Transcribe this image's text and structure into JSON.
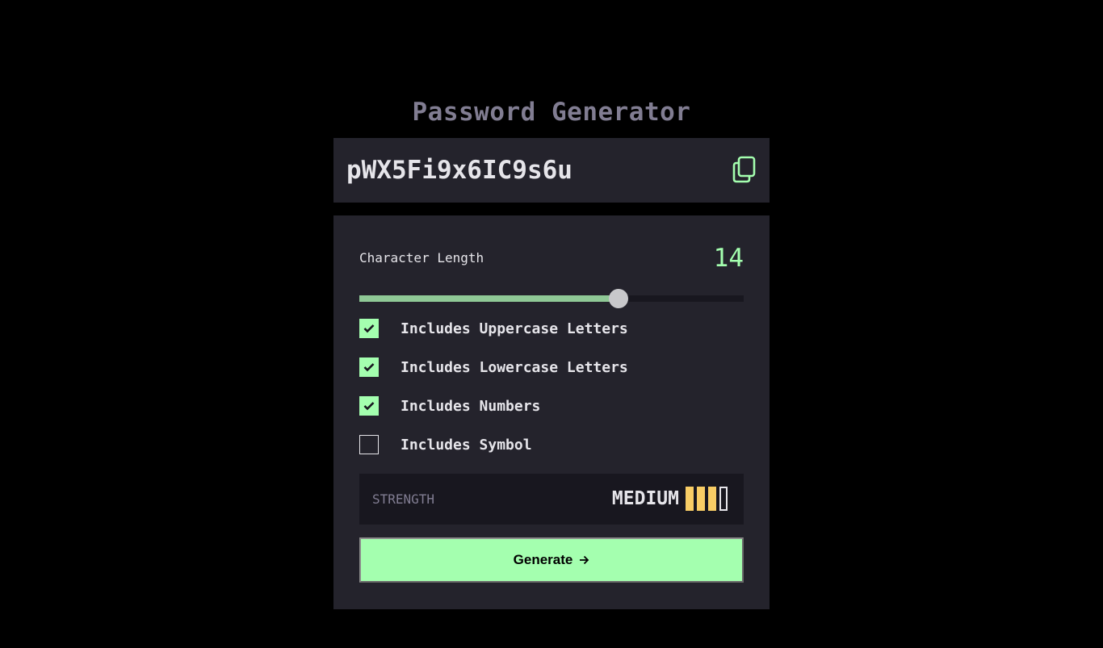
{
  "app": {
    "title": "Password Generator"
  },
  "output": {
    "password": "pWX5Fi9x6IC9s6u",
    "copy_icon": "copy-icon"
  },
  "length": {
    "label": "Character Length",
    "value": "14",
    "slider_fraction": 0.675
  },
  "options": [
    {
      "label": "Includes Uppercase Letters",
      "checked": true
    },
    {
      "label": "Includes Lowercase Letters",
      "checked": true
    },
    {
      "label": "Includes Numbers",
      "checked": true
    },
    {
      "label": "Includes Symbol",
      "checked": false
    }
  ],
  "strength": {
    "label": "STRENGTH",
    "value": "MEDIUM",
    "bars_filled": 3,
    "bars_total": 4
  },
  "generate": {
    "label": "Generate",
    "arrow_icon": "arrow-right-icon"
  },
  "colors": {
    "accent": "#A4FFAF",
    "background": "#000000",
    "panel": "#24232C",
    "strength_medium": "#F8CD65",
    "muted": "#817D92"
  }
}
